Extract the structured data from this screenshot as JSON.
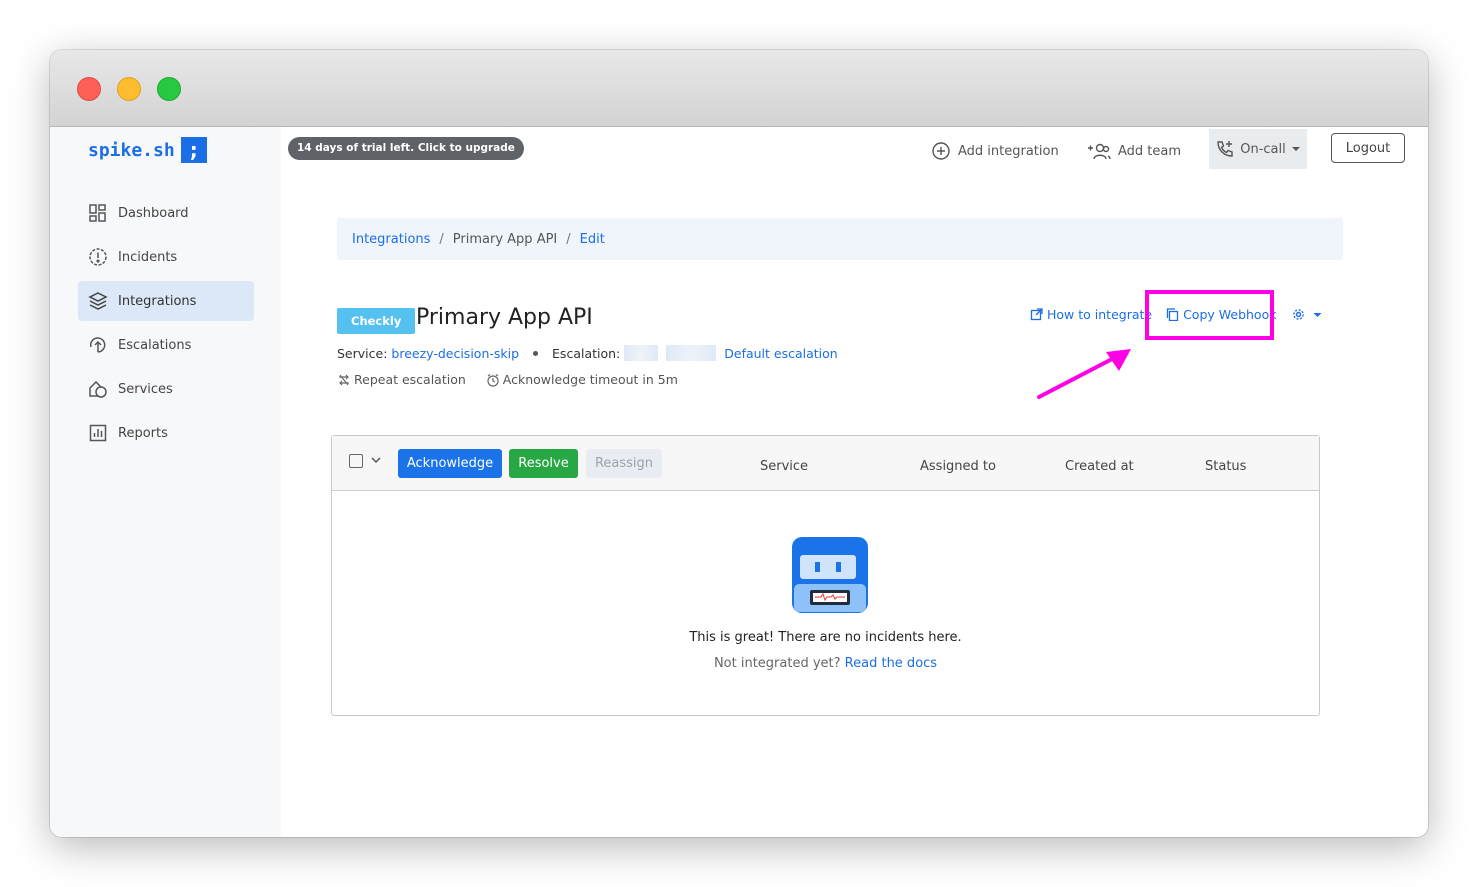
{
  "brand": {
    "name": "spike.sh",
    "mark": ";",
    "accent": "#1b6ee6"
  },
  "trial_banner": "14 days of trial left. Click to upgrade",
  "topnav": {
    "add_integration": "Add integration",
    "add_team": "Add team",
    "on_call": "On-call",
    "logout": "Logout"
  },
  "sidebar": {
    "items": [
      {
        "label": "Dashboard",
        "icon": "dashboard-icon",
        "active": false
      },
      {
        "label": "Incidents",
        "icon": "incidents-icon",
        "active": false
      },
      {
        "label": "Integrations",
        "icon": "integrations-icon",
        "active": true
      },
      {
        "label": "Escalations",
        "icon": "escalations-icon",
        "active": false
      },
      {
        "label": "Services",
        "icon": "services-icon",
        "active": false
      },
      {
        "label": "Reports",
        "icon": "reports-icon",
        "active": false
      }
    ]
  },
  "breadcrumb": [
    "Integrations",
    "Primary App API",
    "Edit"
  ],
  "integration": {
    "badge": "Checkly",
    "badge_color": "#54c1f0",
    "title": "Primary App API",
    "service_label": "Service:",
    "service_value": "breezy-decision-skip",
    "escalation_label": "Escalation:",
    "escalation_value": "Default escalation",
    "repeat_escalation": "Repeat escalation",
    "ack_timeout": "Acknowledge timeout in 5m"
  },
  "actions": {
    "how_to_integrate": "How to integrate",
    "copy_webhook": "Copy Webhook",
    "highlight_color": "#ff00e6"
  },
  "table": {
    "buttons": {
      "acknowledge": "Acknowledge",
      "resolve": "Resolve",
      "reassign": "Reassign"
    },
    "columns": [
      "Service",
      "Assigned to",
      "Created at",
      "Status"
    ],
    "empty_message": "This is great! There are no incidents here.",
    "not_integrated": "Not integrated yet?",
    "docs_link": "Read the docs"
  }
}
